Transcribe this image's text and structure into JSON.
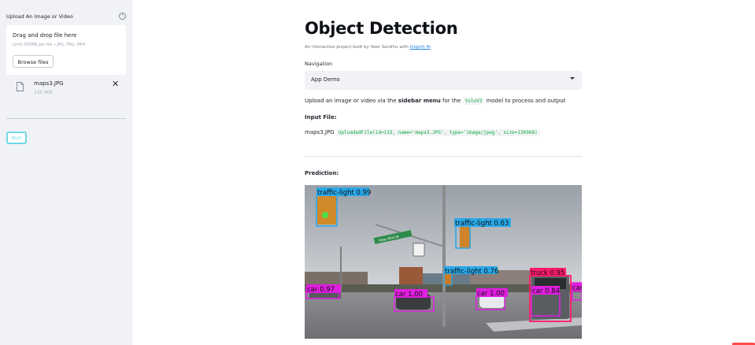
{
  "sidebar": {
    "upload_label": "Upload An Image or Video",
    "help_icon": "?",
    "dropzone_title": "Drag and drop file here",
    "dropzone_limit": "Limit 200MB per file • JPG, PNG, MP4",
    "browse_label": "Browse files",
    "file_name": "maps3.JPG",
    "file_size": "133.7KB",
    "close_glyph": "✕",
    "run_label": "Run"
  },
  "main": {
    "title": "Object Detection",
    "subtitle_prefix": "An interactive project built by Veer Sandhu with ",
    "subtitle_link": "Inspirit AI",
    "nav_label": "Navigation",
    "nav_selected": "App Demo",
    "instr_prefix": "Upload an image or video via the ",
    "instr_bold": "sidebar menu",
    "instr_mid": " for the ",
    "instr_code": "YoloV3",
    "instr_suffix": " model to process and output",
    "input_heading": "Input File:",
    "input_file": "maps3.JPG",
    "input_repr": "UploadedFile(id=133, name='maps3.JPG', type='image/jpeg', size=136968)",
    "prediction_heading": "Prediction:"
  },
  "detections": [
    {
      "label": "traffic-light 0.99"
    },
    {
      "label": "traffic-light 0.63"
    },
    {
      "label": "traffic-light 0.76"
    },
    {
      "label": "truck 0.95"
    },
    {
      "label": "car 0.84"
    },
    {
      "label": "car 0.97"
    },
    {
      "label": "car 1.00"
    },
    {
      "label": "car 1.00"
    },
    {
      "label": "car"
    }
  ],
  "colors": {
    "traffic_light_box": "#29a8e8",
    "car_box": "#e01ee0",
    "truck_box": "#ff1a6c",
    "run_accent": "#6fd9e3",
    "link": "#1c83e1",
    "code": "#09ab3b"
  },
  "street_sign_text": "Pkwy Blvd W"
}
